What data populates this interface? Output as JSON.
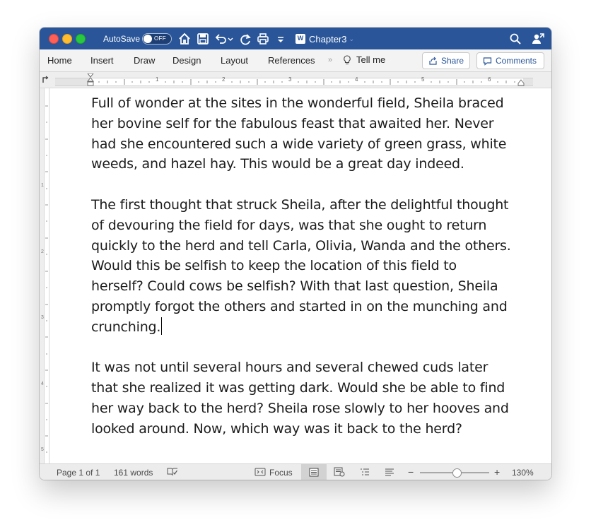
{
  "titlebar": {
    "autosave_label": "AutoSave",
    "autosave_state": "OFF",
    "doc_title": "Chapter3",
    "icons": [
      "home-icon",
      "save-icon",
      "undo-icon",
      "redo-icon",
      "print-icon",
      "customize-toolbar-icon",
      "search-icon",
      "share-person-icon"
    ],
    "color": "#2a5699"
  },
  "ribbon": {
    "tabs": [
      "Home",
      "Insert",
      "Draw",
      "Design",
      "Layout",
      "References"
    ],
    "more": "»",
    "tell_me": "Tell me",
    "share_label": "Share",
    "comments_label": "Comments"
  },
  "ruler": {
    "numbers": [
      "1",
      "2",
      "3",
      "4",
      "5",
      "6"
    ]
  },
  "vertical_ruler": {
    "numbers": [
      "1",
      "2",
      "3",
      "4",
      "5"
    ]
  },
  "document": {
    "paragraphs": [
      "Full of wonder at the sites in the wonderful field, Sheila braced\nher bovine self for the fabulous feast that awaited her. Never\nhad she encountered such a wide variety of green grass, white\nweeds, and hazel hay. This would be a great day indeed.",
      "The first thought that struck Sheila, after the delightful thought\nof devouring the field for days, was that she ought to return\nquickly to the herd and tell Carla, Olivia, Wanda and the others.\nWould this be selfish to keep the location of this field to\nherself? Could cows be selfish? With that last question, Sheila\npromptly forgot the others and started in on the munching and\ncrunching.",
      "It was not until several hours and several chewed cuds later\nthat she realized it was getting dark. Would she be able to find\nher way back to the herd? Sheila rose slowly to her hooves and\nlooked around. Now, which way was it back to the herd?"
    ]
  },
  "statusbar": {
    "page": "Page 1 of 1",
    "words": "161 words",
    "focus": "Focus",
    "zoom_minus": "−",
    "zoom_plus": "+",
    "zoom": "130%",
    "zoom_level": 0.53
  }
}
